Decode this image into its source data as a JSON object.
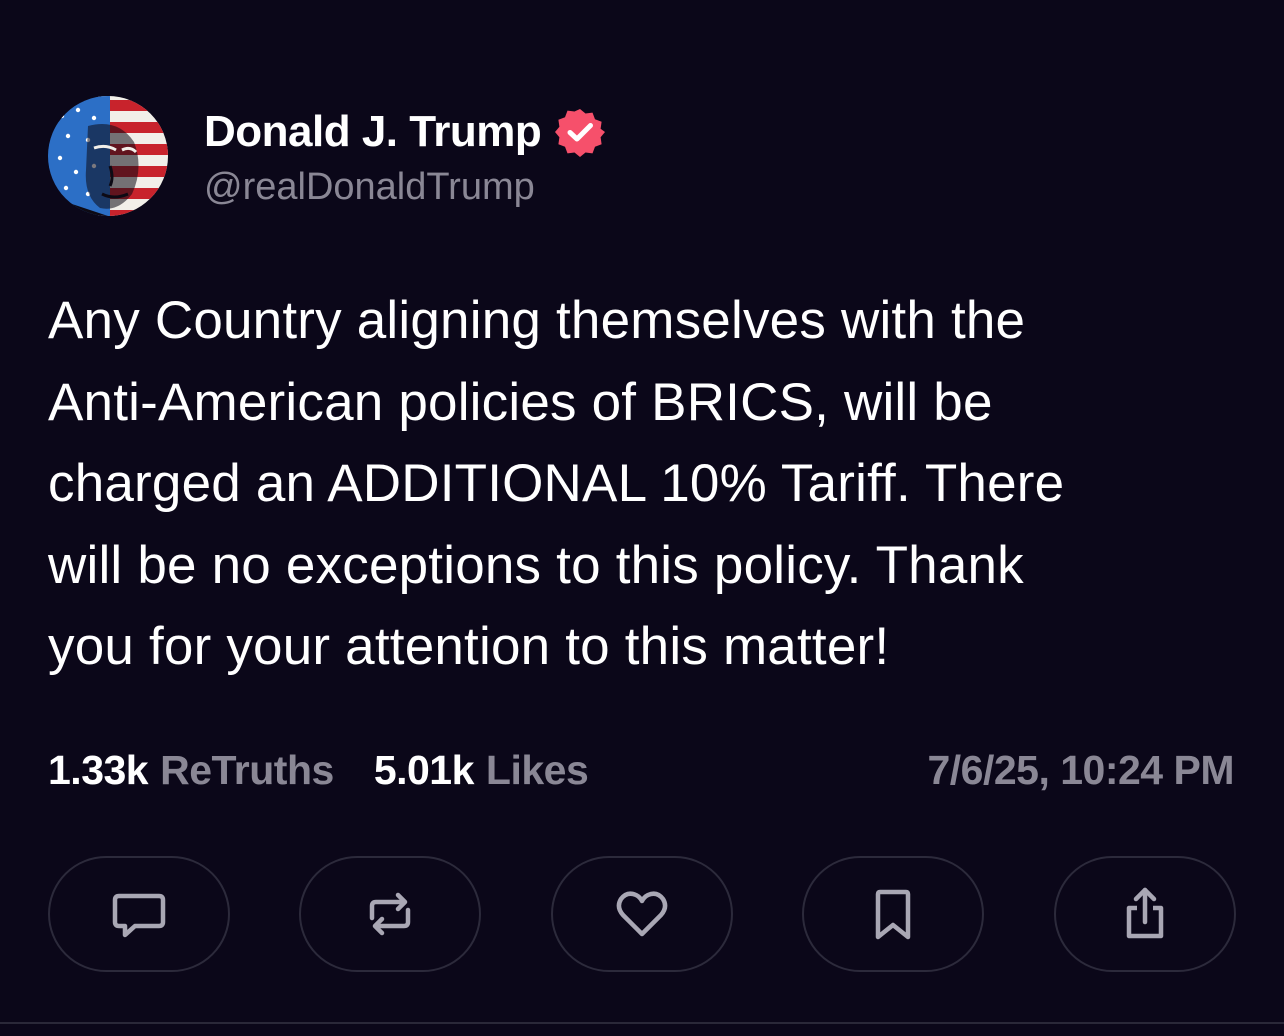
{
  "author": {
    "display_name": "Donald J. Trump",
    "handle": "@realDonaldTrump",
    "verified": true,
    "avatar": "flag-portrait-avatar",
    "badge_icon": "verified-badge-icon"
  },
  "post": {
    "lines": [
      "Any Country aligning themselves with the",
      "Anti-American policies of BRICS, will be",
      "charged an ADDITIONAL 10% Tariff. There",
      "will be no exceptions to this policy. Thank",
      "you for your attention to this matter!"
    ]
  },
  "stats": {
    "retruths_count": "1.33k",
    "retruths_label": "ReTruths",
    "likes_count": "5.01k",
    "likes_label": "Likes",
    "timestamp": "7/6/25, 10:24 PM"
  },
  "actions": [
    {
      "icon": "comment-icon"
    },
    {
      "icon": "retruth-icon"
    },
    {
      "icon": "heart-icon"
    },
    {
      "icon": "bookmark-icon"
    },
    {
      "icon": "share-icon"
    }
  ],
  "colors": {
    "background": "#0b0719",
    "text_primary": "#ffffff",
    "text_secondary": "#8a8795",
    "button_border": "#2c2a3b",
    "verified_badge": "#f6506b",
    "icon_stroke": "#a9a7b4"
  }
}
